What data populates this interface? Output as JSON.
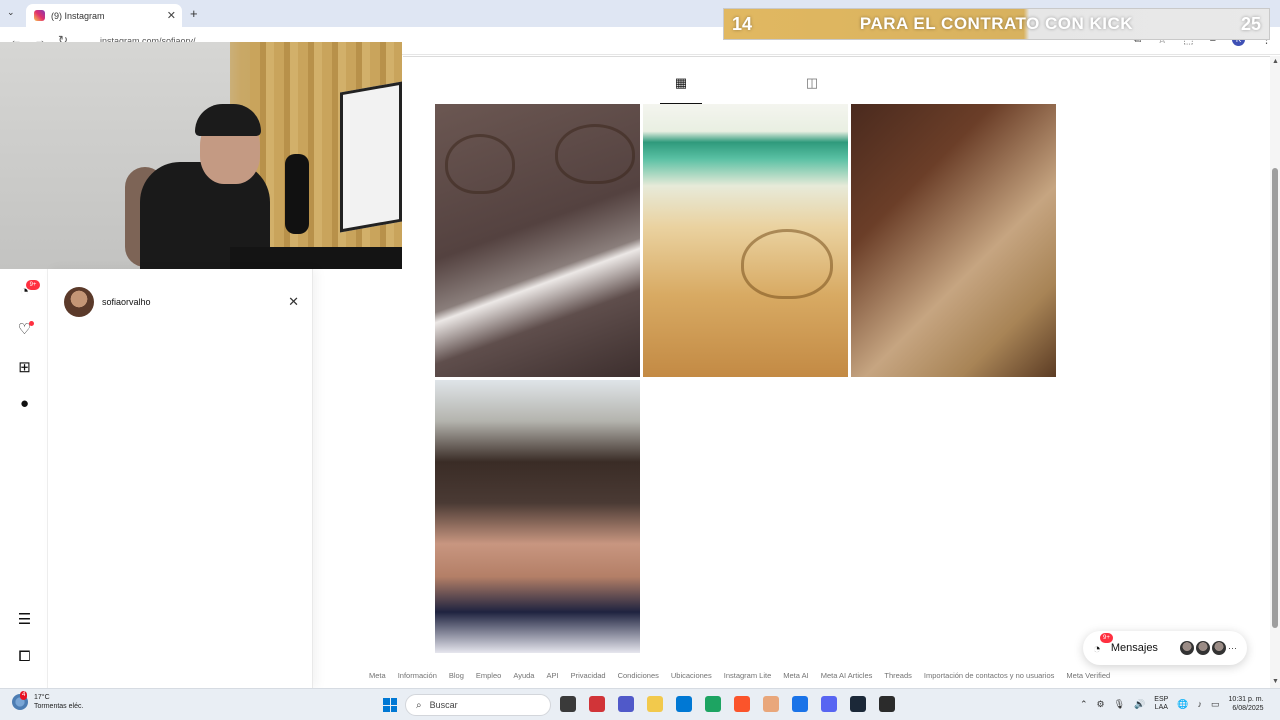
{
  "browser": {
    "tab_title": "(9) Instagram",
    "url": "instagram.com/sofiaorv/",
    "new_tab": "+",
    "close": "✕"
  },
  "overlay": {
    "left_number": "14",
    "center_text": "PARA EL CONTRATO CON KICK",
    "right_number": "25",
    "colors": {
      "gold": "#d8b25f",
      "gray": "#e6e6e6"
    }
  },
  "nav_rail": {
    "messages_badge": "9+",
    "icons": [
      "messenger-icon",
      "heart-icon",
      "create-icon",
      "profile-avatar",
      "menu-icon",
      "more-icon"
    ]
  },
  "search_panel": {
    "recent": [
      {
        "username": "sofiaorvalho"
      }
    ],
    "close_label": "✕"
  },
  "profile_tabs": {
    "items": [
      {
        "icon": "grid-icon",
        "active": true
      },
      {
        "icon": "tagged-icon",
        "active": false
      }
    ]
  },
  "posts": [
    {
      "name": "post-heart-sand-waves"
    },
    {
      "name": "post-heart-beach"
    },
    {
      "name": "post-nutella-danbo"
    },
    {
      "name": "post-girl-bow"
    }
  ],
  "messages": {
    "label": "Mensajes",
    "badge": "9+",
    "more": "···"
  },
  "footer": {
    "links": [
      "Meta",
      "Información",
      "Blog",
      "Empleo",
      "Ayuda",
      "API",
      "Privacidad",
      "Condiciones",
      "Ubicaciones",
      "Instagram Lite",
      "Meta AI",
      "Meta AI Articles",
      "Threads",
      "Importación de contactos y no usuarios",
      "Meta Verified"
    ]
  },
  "taskbar": {
    "weather_temp": "17°C",
    "weather_desc": "Tormentas eléc.",
    "weather_badge": "4",
    "search_placeholder": "Buscar",
    "lang_line1": "ESP",
    "lang_line2": "LAA",
    "time": "10:31 p. m.",
    "date": "6/08/2025",
    "app_colors": [
      "#3a3a3a",
      "#d13438",
      "#5059c9",
      "#f2c94c",
      "#0078d4",
      "#1da462",
      "#fb542b",
      "#e9a77b",
      "#1a73e8",
      "#5865f2",
      "#1b2838",
      "#2b2b2b"
    ]
  }
}
